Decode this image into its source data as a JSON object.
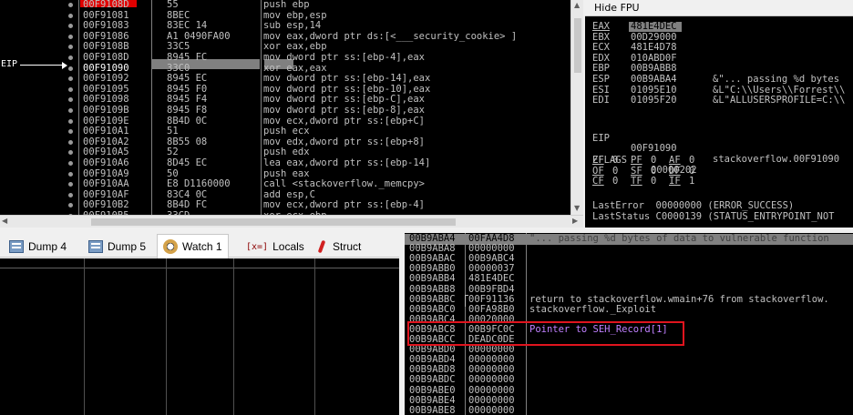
{
  "disasm": {
    "eip_label": "EIP",
    "rows": [
      {
        "addr": "00F9108D",
        "hex": "55",
        "ins": "push ebp"
      },
      {
        "addr": "00F91081",
        "hex": "8BEC",
        "ins": "mov ebp,esp"
      },
      {
        "addr": "00F91083",
        "hex": "83EC 14",
        "ins": "sub esp,14"
      },
      {
        "addr": "00F91086",
        "hex": "A1 0490FA00",
        "ins": "mov eax,dword ptr ds:[<___security_cookie> ]"
      },
      {
        "addr": "00F9108B",
        "hex": "33C5",
        "ins": "xor eax,ebp"
      },
      {
        "addr": "00F9108D",
        "hex": "8945 FC",
        "ins": "mov dword ptr ss:[ebp-4],eax"
      },
      {
        "addr": "00F91090",
        "hex": "33C0",
        "ins": "xor eax,eax"
      },
      {
        "addr": "00F91092",
        "hex": "8945 EC",
        "ins": "mov dword ptr ss:[ebp-14],eax"
      },
      {
        "addr": "00F91095",
        "hex": "8945 F0",
        "ins": "mov dword ptr ss:[ebp-10],eax"
      },
      {
        "addr": "00F91098",
        "hex": "8945 F4",
        "ins": "mov dword ptr ss:[ebp-C],eax"
      },
      {
        "addr": "00F9109B",
        "hex": "8945 F8",
        "ins": "mov dword ptr ss:[ebp-8],eax"
      },
      {
        "addr": "00F9109E",
        "hex": "8B4D 0C",
        "ins": "mov ecx,dword ptr ss:[ebp+C]"
      },
      {
        "addr": "00F910A1",
        "hex": "51",
        "ins": "push ecx"
      },
      {
        "addr": "00F910A2",
        "hex": "8B55 08",
        "ins": "mov edx,dword ptr ss:[ebp+8]"
      },
      {
        "addr": "00F910A5",
        "hex": "52",
        "ins": "push edx"
      },
      {
        "addr": "00F910A6",
        "hex": "8D45 EC",
        "ins": "lea eax,dword ptr ss:[ebp-14]"
      },
      {
        "addr": "00F910A9",
        "hex": "50",
        "ins": "push eax"
      },
      {
        "addr": "00F910AA",
        "hex": "E8 D1160000",
        "ins": "call <stackoverflow._memcpy>"
      },
      {
        "addr": "00F910AF",
        "hex": "83C4 0C",
        "ins": "add esp,C"
      },
      {
        "addr": "00F910B2",
        "hex": "8B4D FC",
        "ins": "mov ecx,dword ptr ss:[ebp-4]"
      },
      {
        "addr": "00F910B5",
        "hex": "33CD",
        "ins": "xor ecx,ebp"
      }
    ]
  },
  "registers": {
    "header": "Hide FPU",
    "rows": [
      {
        "name": "EAX",
        "value": "481E4DEC",
        "comment": ""
      },
      {
        "name": "EBX",
        "value": "00D29000",
        "comment": ""
      },
      {
        "name": "ECX",
        "value": "481E4D78",
        "comment": ""
      },
      {
        "name": "EDX",
        "value": "010ABD0F",
        "comment": ""
      },
      {
        "name": "EBP",
        "value": "00B9ABB8",
        "comment": ""
      },
      {
        "name": "ESP",
        "value": "00B9ABA4",
        "comment": "&\"... passing %d bytes"
      },
      {
        "name": "ESI",
        "value": "01095E10",
        "comment": "&L\"C:\\\\Users\\\\Forrest\\\\"
      },
      {
        "name": "EDI",
        "value": "01095F20",
        "comment": "&L\"ALLUSERSPROFILE=C:\\\\"
      }
    ],
    "eip": {
      "name": "EIP",
      "value": "00F91090",
      "comment": "stackoverflow.00F91090"
    },
    "eflags": {
      "name": "EFLAGS",
      "value": "00000202"
    },
    "flags": [
      {
        "n": "ZF",
        "v": "0"
      },
      {
        "n": "PF",
        "v": "0"
      },
      {
        "n": "AF",
        "v": "0"
      },
      {
        "n": "OF",
        "v": "0"
      },
      {
        "n": "SF",
        "v": "0"
      },
      {
        "n": "DF",
        "v": "0"
      },
      {
        "n": "CF",
        "v": "0"
      },
      {
        "n": "TF",
        "v": "0"
      },
      {
        "n": "IF",
        "v": "1"
      }
    ],
    "last_error": "LastError  00000000 (ERROR_SUCCESS)",
    "last_status": "LastStatus C0000139 (STATUS_ENTRYPOINT_NOT"
  },
  "tabs": [
    {
      "label": "Dump 4",
      "icon": "dump-icon"
    },
    {
      "label": "Dump 5",
      "icon": "dump-icon"
    },
    {
      "label": "Watch 1",
      "icon": "watch-icon"
    },
    {
      "label": "Locals",
      "icon": "locals-icon",
      "icon_text": "[x=]"
    },
    {
      "label": "Struct",
      "icon": "struct-icon"
    }
  ],
  "stack": {
    "rows": [
      {
        "addr": "00B9ABA4",
        "val": "00FAA4D8",
        "cmt": "\"... passing %d bytes of data to vulnerable function"
      },
      {
        "addr": "00B9ABA8",
        "val": "00000000",
        "cmt": ""
      },
      {
        "addr": "00B9ABAC",
        "val": "00B9ABC4",
        "cmt": ""
      },
      {
        "addr": "00B9ABB0",
        "val": "00000037",
        "cmt": ""
      },
      {
        "addr": "00B9ABB4",
        "val": "481E4DEC",
        "cmt": ""
      },
      {
        "addr": "00B9ABB8",
        "val": "00B9FBD4",
        "cmt": ""
      },
      {
        "addr": "00B9ABBC",
        "val": "00F91136",
        "cmt": "return to stackoverflow.wmain+76 from stackoverflow."
      },
      {
        "addr": "00B9ABC0",
        "val": "00FA98B0",
        "cmt": "stackoverflow._Exploit"
      },
      {
        "addr": "00B9ABC4",
        "val": "00020000",
        "cmt": ""
      },
      {
        "addr": "00B9ABC8",
        "val": "00B9FC0C",
        "cmt": "Pointer to SEH_Record[1]"
      },
      {
        "addr": "00B9ABCC",
        "val": "DEADC0DE",
        "cmt": ""
      },
      {
        "addr": "00B9ABD0",
        "val": "00000000",
        "cmt": ""
      },
      {
        "addr": "00B9ABD4",
        "val": "00000000",
        "cmt": ""
      },
      {
        "addr": "00B9ABD8",
        "val": "00000000",
        "cmt": ""
      },
      {
        "addr": "00B9ABDC",
        "val": "00000000",
        "cmt": ""
      },
      {
        "addr": "00B9ABE0",
        "val": "00000000",
        "cmt": ""
      },
      {
        "addr": "00B9ABE4",
        "val": "00000000",
        "cmt": ""
      },
      {
        "addr": "00B9ABE8",
        "val": "00000000",
        "cmt": ""
      }
    ]
  },
  "colors": {
    "highlight_red": "#e00000",
    "seh_box": "#e0141e",
    "seh_comment": "#c080ff"
  }
}
